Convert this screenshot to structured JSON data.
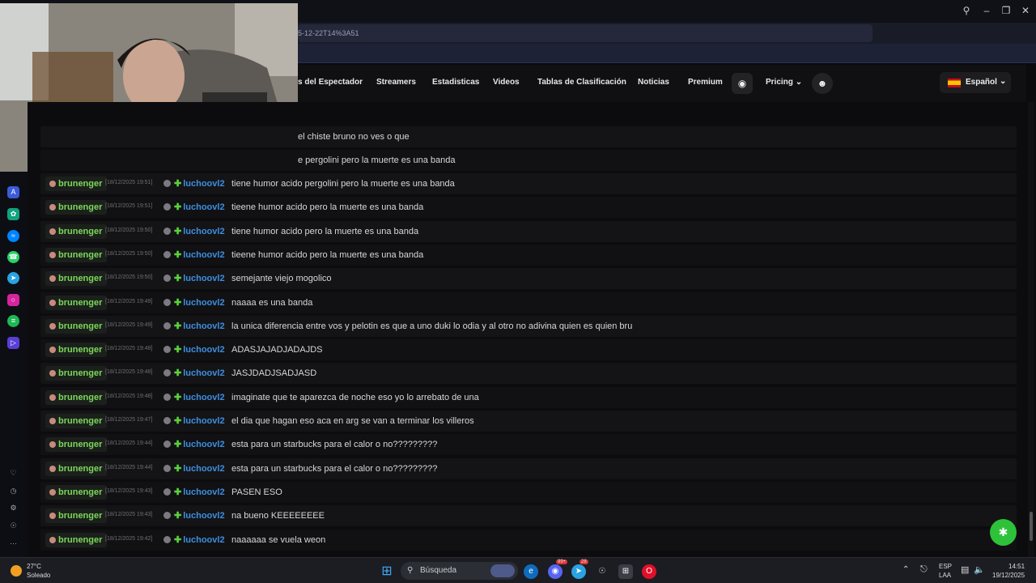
{
  "browser": {
    "url_fragment": "5-12-22T14%3A51"
  },
  "site_nav": {
    "links": [
      "s del Espectador",
      "Streamers",
      "Estadisticas",
      "Videos",
      "Tablas de Clasificación",
      "Noticias",
      "Premium"
    ],
    "pricing_label": "Pricing",
    "language_label": "Español"
  },
  "chat": {
    "partial_rows": [
      "el chiste bruno no ves o que",
      "e pergolini pero la muerte es una banda"
    ],
    "rows": [
      {
        "user": "brunenger",
        "time": "[18/12/2025 19:51]",
        "sender": "luchoovl2",
        "message": "tiene humor acido pergolini pero la muerte es una banda"
      },
      {
        "user": "brunenger",
        "time": "[18/12/2025 19:51]",
        "sender": "luchoovl2",
        "message": "tieene humor acido pero la muerte es una banda"
      },
      {
        "user": "brunenger",
        "time": "[18/12/2025 19:50]",
        "sender": "luchoovl2",
        "message": "tiene humor acido pero la muerte es una banda"
      },
      {
        "user": "brunenger",
        "time": "[18/12/2025 19:50]",
        "sender": "luchoovl2",
        "message": "tieene humor acido pero la muerte es una banda"
      },
      {
        "user": "brunenger",
        "time": "[18/12/2025 19:50]",
        "sender": "luchoovl2",
        "message": "semejante viejo mogolico"
      },
      {
        "user": "brunenger",
        "time": "[18/12/2025 19:49]",
        "sender": "luchoovl2",
        "message": "naaaa es una banda"
      },
      {
        "user": "brunenger",
        "time": "[18/12/2025 19:49]",
        "sender": "luchoovl2",
        "message": "la unica diferencia entre vos y pelotin es que a uno duki lo odia y al otro no adivina quien es quien bru"
      },
      {
        "user": "brunenger",
        "time": "[18/12/2025 19:48]",
        "sender": "luchoovl2",
        "message": "ADASJAJADJADAJDS"
      },
      {
        "user": "brunenger",
        "time": "[18/12/2025 19:48]",
        "sender": "luchoovl2",
        "message": "JASJDADJSADJASD"
      },
      {
        "user": "brunenger",
        "time": "[18/12/2025 19:48]",
        "sender": "luchoovl2",
        "message": "imaginate que te aparezca de noche eso yo lo arrebato de una"
      },
      {
        "user": "brunenger",
        "time": "[18/12/2025 19:47]",
        "sender": "luchoovl2",
        "message": "el dia que hagan eso aca en arg se van a terminar los villeros"
      },
      {
        "user": "brunenger",
        "time": "[18/12/2025 19:44]",
        "sender": "luchoovl2",
        "message": "esta para un starbucks para el calor o no?????????"
      },
      {
        "user": "brunenger",
        "time": "[18/12/2025 19:44]",
        "sender": "luchoovl2",
        "message": "esta para un starbucks para el calor o no?????????"
      },
      {
        "user": "brunenger",
        "time": "[18/12/2025 19:43]",
        "sender": "luchoovl2",
        "message": "PASEN ESO"
      },
      {
        "user": "brunenger",
        "time": "[18/12/2025 19:43]",
        "sender": "luchoovl2",
        "message": "na bueno KEEEEEEEE"
      },
      {
        "user": "brunenger",
        "time": "[18/12/2025 19:42]",
        "sender": "luchoovl2",
        "message": "naaaaaa se vuela weon"
      }
    ]
  },
  "taskbar": {
    "weather_temp": "27°C",
    "weather_desc": "Soleado",
    "search_placeholder": "Búsqueda",
    "lang_top": "ESP",
    "lang_bottom": "LAA",
    "time": "14:51",
    "date": "19/12/2025",
    "badge_1": "99+",
    "badge_2": "28"
  },
  "colors": {
    "user_green": "#7cd85a",
    "sender_blue": "#3d8fe0",
    "share_green": "#2ec23a"
  }
}
